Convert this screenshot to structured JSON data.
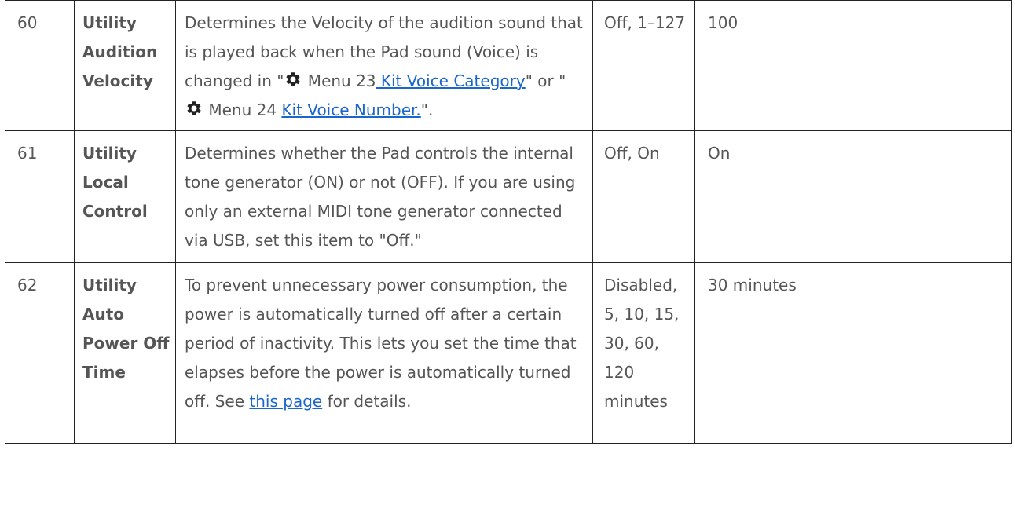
{
  "rows": [
    {
      "number": "60",
      "name": "Utility Audition Velocity",
      "description": {
        "part1": "Determines the Velocity of the audition sound that is played back when the Pad sound (Voice) is changed in \"",
        "menu1": " Menu 23",
        "link1": " Kit Voice Category",
        "part2": "\" or \"",
        "menu2": " Menu 24 ",
        "link2": "Kit Voice Number.",
        "part3": "\"."
      },
      "range": "Off, 1–127",
      "default": "100",
      "icon": "gear-icon"
    },
    {
      "number": "61",
      "name": "Utility Local Control",
      "description": "Determines whether the Pad controls the internal tone generator (ON) or not (OFF). If you are using only an external MIDI tone generator connected via USB, set this item to \"Off.\"",
      "range": "Off, On",
      "default": "On"
    },
    {
      "number": "62",
      "name": "Utility Auto Power Off Time",
      "description": {
        "part1": "To prevent unnecessary power consumption, the power is automatically turned off after a certain period of inactivity. This lets you set the time that elapses before the power is automatically turned off. See ",
        "link": "this page",
        "part2": " for details."
      },
      "range": "Disabled, 5, 10, 15, 30, 60, 120 minutes",
      "default": "30 minutes"
    }
  ],
  "colors": {
    "text": "#555555",
    "link": "#1a66cc",
    "border": "#222222"
  }
}
